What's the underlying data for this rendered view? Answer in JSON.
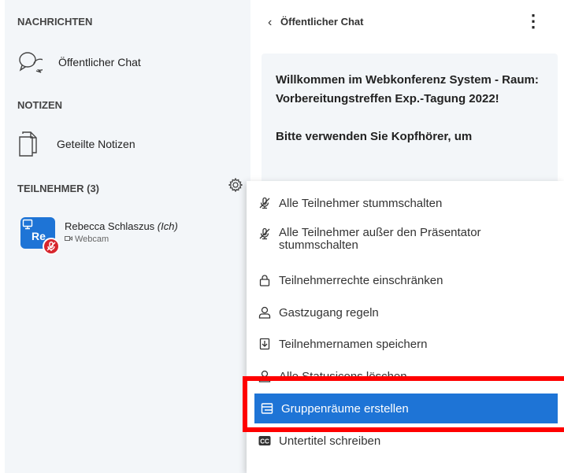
{
  "sidebar": {
    "messages_title": "NACHRICHTEN",
    "public_chat_label": "Öffentlicher Chat",
    "notes_title": "NOTIZEN",
    "shared_notes_label": "Geteilte Notizen",
    "participants_title": "TEILNEHMER (3)",
    "user": {
      "initials": "Re",
      "name": "Rebecca Schlaszus",
      "self_tag": "(Ich)",
      "status": "Webcam"
    }
  },
  "chat": {
    "title": "Öffentlicher Chat",
    "welcome_text": "Willkommen im Webkonferenz System - Raum: Vorbereitungstreffen Exp.-Tagung 2022!",
    "welcome_text_2": "Bitte verwenden Sie Kopfhörer, um"
  },
  "menu": {
    "items": [
      {
        "label": "Alle Teilnehmer stummschalten",
        "icon": "mic-off-icon"
      },
      {
        "label": "Alle Teilnehmer außer den Präsentator stummschalten",
        "icon": "mic-off-icon"
      },
      {
        "label": "Teilnehmerrechte einschränken",
        "icon": "lock-icon"
      },
      {
        "label": "Gastzugang regeln",
        "icon": "user-icon"
      },
      {
        "label": "Teilnehmernamen speichern",
        "icon": "download-icon"
      },
      {
        "label": "Alle Statusicons löschen",
        "icon": "user-icon"
      },
      {
        "label": "Gruppenräume erstellen",
        "icon": "rooms-icon"
      },
      {
        "label": "Untertitel schreiben",
        "icon": "cc-icon"
      }
    ]
  },
  "colors": {
    "accent": "#1e74d6",
    "highlight_box": "#ff0000",
    "sidebar_bg": "#f3f6f9"
  }
}
